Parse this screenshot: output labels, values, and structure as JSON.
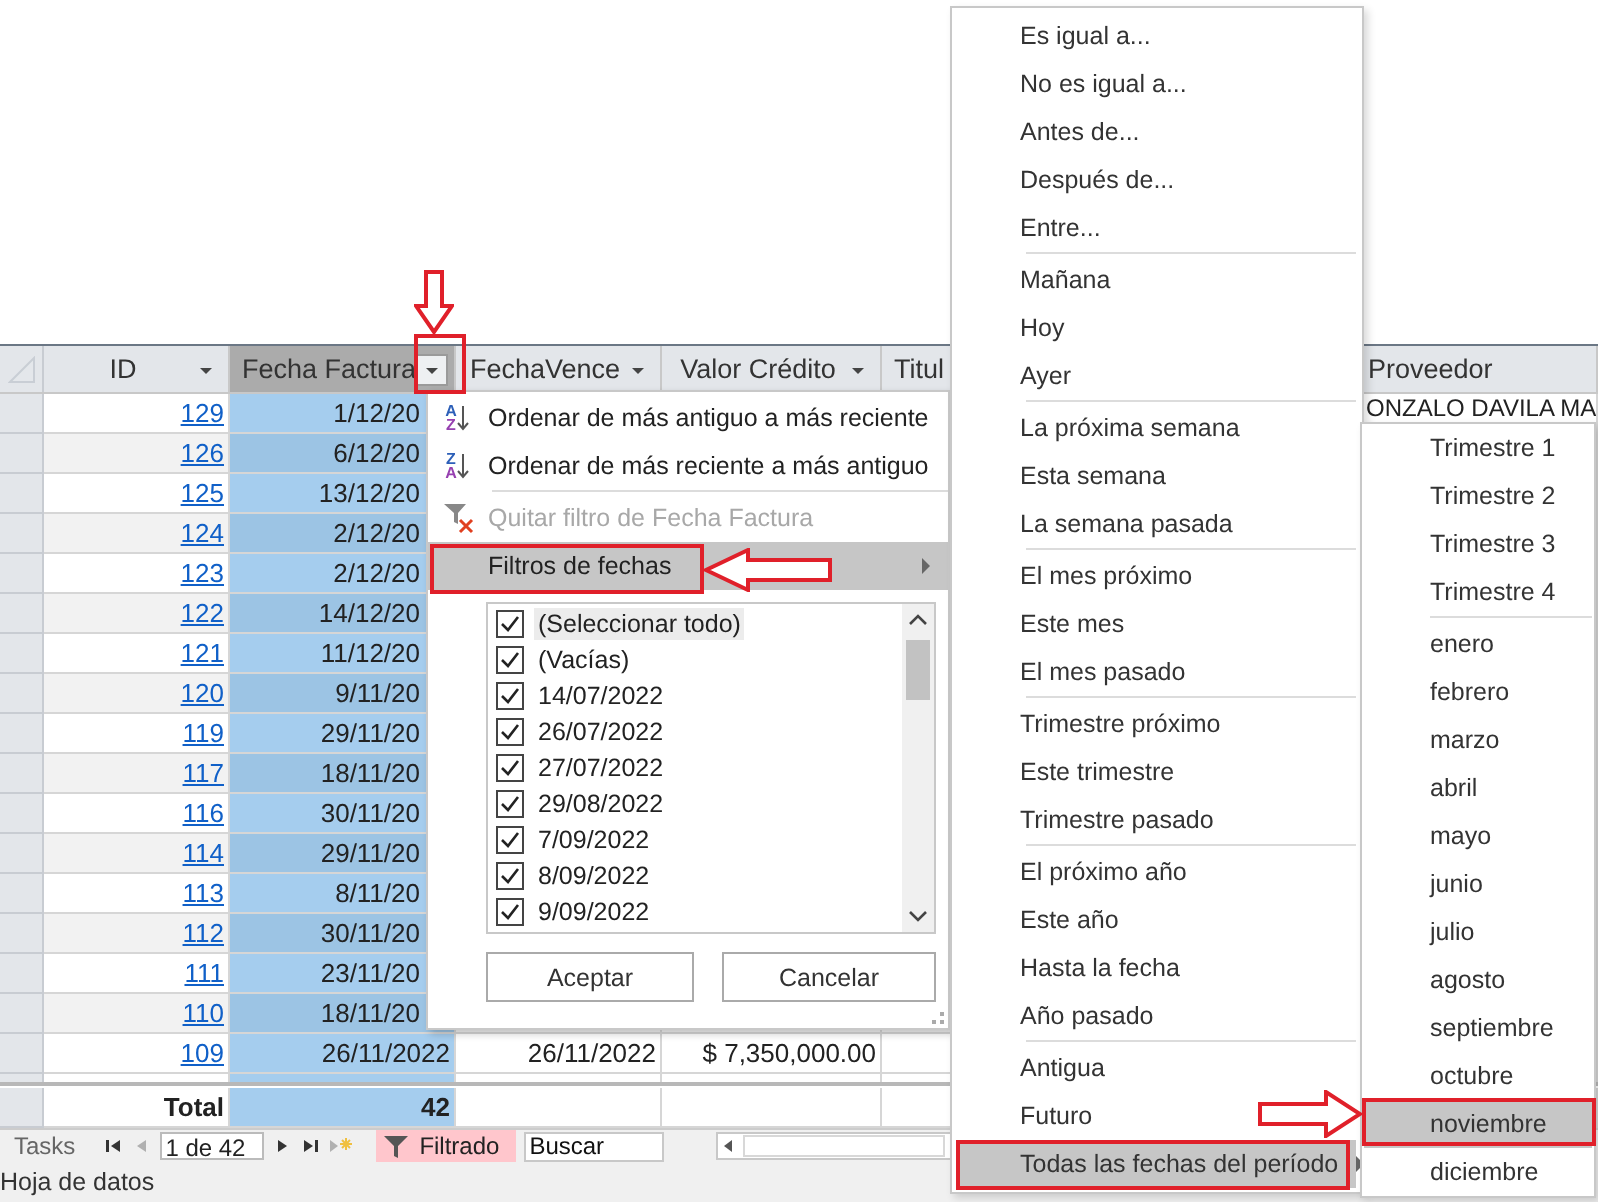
{
  "datasheet": {
    "columns": [
      {
        "label": "ID",
        "selected": false,
        "dropdown": true
      },
      {
        "label": "Fecha Factura",
        "selected": true,
        "dropdown": true
      },
      {
        "label": "FechaVence",
        "selected": false,
        "dropdown": true
      },
      {
        "label": "Valor Crédito",
        "selected": false,
        "dropdown": true
      },
      {
        "label": "Titul",
        "selected": false,
        "dropdown": false
      },
      {
        "label": "Proveedor",
        "selected": false,
        "dropdown": false
      }
    ],
    "rows": [
      {
        "id": "129",
        "fecha_factura": "1/12/20",
        "proveedor": "ONZALO DAVILA MA"
      },
      {
        "id": "126",
        "fecha_factura": "6/12/20"
      },
      {
        "id": "125",
        "fecha_factura": "13/12/20"
      },
      {
        "id": "124",
        "fecha_factura": "2/12/20"
      },
      {
        "id": "123",
        "fecha_factura": "2/12/20"
      },
      {
        "id": "122",
        "fecha_factura": "14/12/20"
      },
      {
        "id": "121",
        "fecha_factura": "11/12/20"
      },
      {
        "id": "120",
        "fecha_factura": "9/11/20"
      },
      {
        "id": "119",
        "fecha_factura": "29/11/20"
      },
      {
        "id": "117",
        "fecha_factura": "18/11/20"
      },
      {
        "id": "116",
        "fecha_factura": "30/11/20"
      },
      {
        "id": "114",
        "fecha_factura": "29/11/20"
      },
      {
        "id": "113",
        "fecha_factura": "8/11/20"
      },
      {
        "id": "112",
        "fecha_factura": "30/11/20"
      },
      {
        "id": "111",
        "fecha_factura": "23/11/20"
      },
      {
        "id": "110",
        "fecha_factura": "18/11/20"
      },
      {
        "id": "109",
        "fecha_factura": "26/11/2022",
        "fecha_vence": "26/11/2022",
        "valor_credito": "$ 7,350,000.00"
      }
    ],
    "total": {
      "label": "Total",
      "count": "42"
    }
  },
  "navigation": {
    "label": "Tasks",
    "record": "1 de 42",
    "filter": "Filtrado",
    "filtered": true,
    "search": {
      "placeholder": "Buscar"
    }
  },
  "status_bar": {
    "text": "Hoja de datos"
  },
  "filter_menu": {
    "items": [
      {
        "kind": "sort",
        "icon_top": "A",
        "icon_bottom": "Z",
        "label": "Ordenar de más antiguo a más reciente",
        "disabled": false,
        "selected": false
      },
      {
        "kind": "sort",
        "icon_top": "Z",
        "icon_bottom": "A",
        "label": "Ordenar de más reciente a más antiguo",
        "disabled": false,
        "selected": false
      },
      {
        "kind": "clear",
        "label": "Quitar filtro de Fecha Factura",
        "disabled": true,
        "selected": false
      },
      {
        "kind": "submenu",
        "label": "Filtros de fechas",
        "disabled": false,
        "selected": true
      }
    ],
    "values": [
      {
        "label": "(Seleccionar todo)",
        "checked": true,
        "selected": true
      },
      {
        "label": "(Vacías)",
        "checked": true,
        "selected": false
      },
      {
        "label": "14/07/2022",
        "checked": true,
        "selected": false
      },
      {
        "label": "26/07/2022",
        "checked": true,
        "selected": false
      },
      {
        "label": "27/07/2022",
        "checked": true,
        "selected": false
      },
      {
        "label": "29/08/2022",
        "checked": true,
        "selected": false
      },
      {
        "label": "7/09/2022",
        "checked": true,
        "selected": false
      },
      {
        "label": "8/09/2022",
        "checked": true,
        "selected": false
      },
      {
        "label": "9/09/2022",
        "checked": true,
        "selected": false
      }
    ],
    "buttons": [
      "Aceptar",
      "Cancelar"
    ]
  },
  "date_menu": {
    "groups": [
      {
        "items": [
          {
            "label": "Es igual a...",
            "selected": false,
            "submenu": false
          },
          {
            "label": "No es igual a...",
            "selected": false,
            "submenu": false
          },
          {
            "label": "Antes de...",
            "selected": false,
            "submenu": false
          },
          {
            "label": "Después de...",
            "selected": false,
            "submenu": false
          },
          {
            "label": "Entre...",
            "selected": false,
            "submenu": false
          }
        ]
      },
      {
        "items": [
          {
            "label": "Mañana",
            "selected": false,
            "submenu": false
          },
          {
            "label": "Hoy",
            "selected": false,
            "submenu": false
          },
          {
            "label": "Ayer",
            "selected": false,
            "submenu": false
          }
        ]
      },
      {
        "items": [
          {
            "label": "La próxima semana",
            "selected": false,
            "submenu": false
          },
          {
            "label": "Esta semana",
            "selected": false,
            "submenu": false
          },
          {
            "label": "La semana pasada",
            "selected": false,
            "submenu": false
          }
        ]
      },
      {
        "items": [
          {
            "label": "El mes próximo",
            "selected": false,
            "submenu": false
          },
          {
            "label": "Este mes",
            "selected": false,
            "submenu": false
          },
          {
            "label": "El mes pasado",
            "selected": false,
            "submenu": false
          }
        ]
      },
      {
        "items": [
          {
            "label": "Trimestre próximo",
            "selected": false,
            "submenu": false
          },
          {
            "label": "Este trimestre",
            "selected": false,
            "submenu": false
          },
          {
            "label": "Trimestre pasado",
            "selected": false,
            "submenu": false
          }
        ]
      },
      {
        "items": [
          {
            "label": "El próximo año",
            "selected": false,
            "submenu": false
          },
          {
            "label": "Este año",
            "selected": false,
            "submenu": false
          },
          {
            "label": "Hasta la fecha",
            "selected": false,
            "submenu": false
          },
          {
            "label": "Año pasado",
            "selected": false,
            "submenu": false
          }
        ]
      },
      {
        "items": [
          {
            "label": "Antigua",
            "selected": false,
            "submenu": false
          },
          {
            "label": "Futuro",
            "selected": false,
            "submenu": false
          },
          {
            "label": "Todas las fechas del período",
            "selected": true,
            "submenu": true
          }
        ]
      }
    ]
  },
  "period_menu": {
    "groups": [
      {
        "items": [
          {
            "label": "Trimestre 1",
            "selected": false
          },
          {
            "label": "Trimestre 2",
            "selected": false
          },
          {
            "label": "Trimestre 3",
            "selected": false
          },
          {
            "label": "Trimestre 4",
            "selected": false
          }
        ]
      },
      {
        "items": [
          {
            "label": "enero",
            "selected": false
          },
          {
            "label": "febrero",
            "selected": false
          },
          {
            "label": "marzo",
            "selected": false
          },
          {
            "label": "abril",
            "selected": false
          },
          {
            "label": "mayo",
            "selected": false
          },
          {
            "label": "junio",
            "selected": false
          },
          {
            "label": "julio",
            "selected": false
          },
          {
            "label": "agosto",
            "selected": false
          },
          {
            "label": "septiembre",
            "selected": false
          },
          {
            "label": "octubre",
            "selected": false
          },
          {
            "label": "noviembre",
            "selected": true
          },
          {
            "label": "diciembre",
            "selected": false
          }
        ]
      }
    ]
  }
}
